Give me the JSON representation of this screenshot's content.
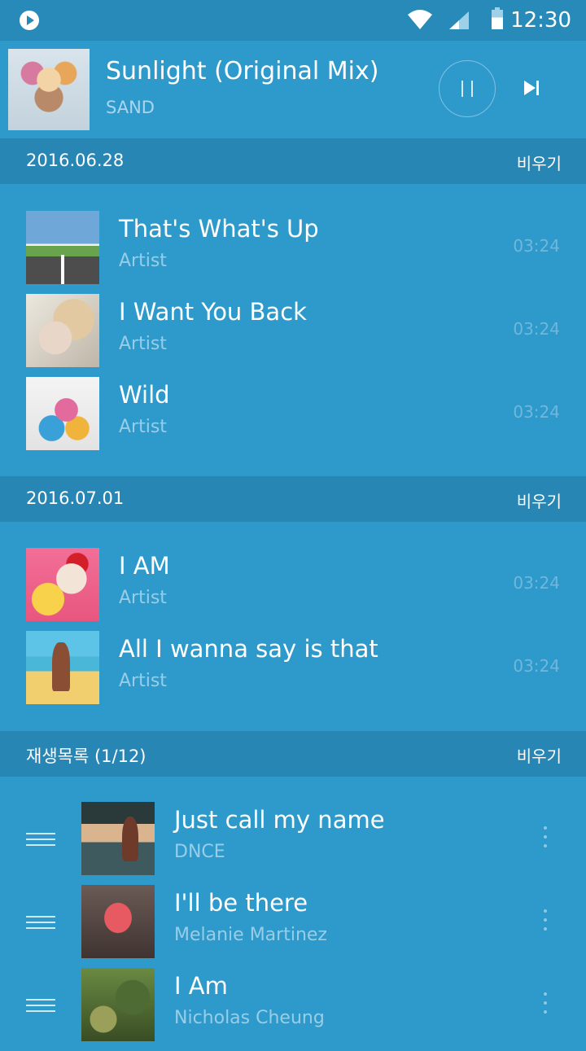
{
  "status_bar": {
    "time": "12:30"
  },
  "now_playing": {
    "title": "Sunlight (Original Mix)",
    "artist": "SAND"
  },
  "sections": [
    {
      "date": "2016.06.28",
      "clear_label": "비우기",
      "songs": [
        {
          "title": "That's What's Up",
          "artist": "Artist",
          "duration": "03:24"
        },
        {
          "title": "I Want You Back",
          "artist": "Artist",
          "duration": "03:24"
        },
        {
          "title": "Wild",
          "artist": "Artist",
          "duration": "03:24"
        }
      ]
    },
    {
      "date": "2016.07.01",
      "clear_label": "비우기",
      "songs": [
        {
          "title": "I AM",
          "artist": "Artist",
          "duration": "03:24"
        },
        {
          "title": "All I wanna say is that",
          "artist": "Artist",
          "duration": "03:24"
        }
      ]
    }
  ],
  "playlist": {
    "title": "재생목록 (1/12)",
    "clear_label": "비우기",
    "songs": [
      {
        "title": "Just call my name",
        "artist": "DNCE"
      },
      {
        "title": "I'll be there",
        "artist": "Melanie Martinez"
      },
      {
        "title": "I Am",
        "artist": "Nicholas Cheung"
      }
    ]
  }
}
